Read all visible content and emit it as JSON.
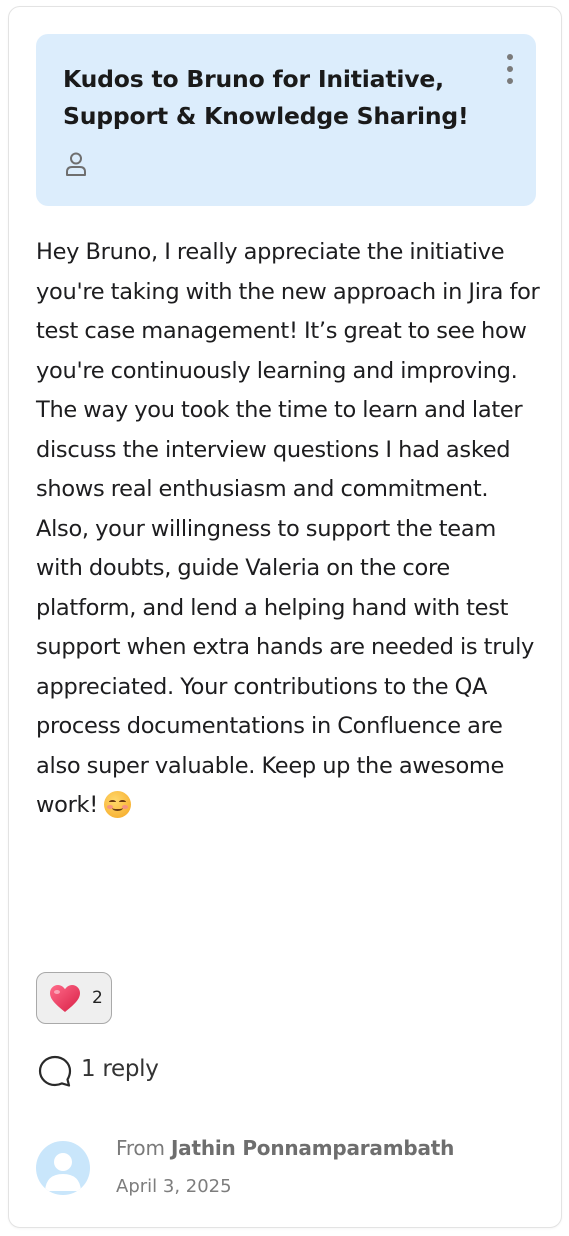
{
  "post": {
    "title": "Kudos to Bruno for Initiative, Support & Knowledge Sharing!",
    "message": "Hey Bruno, I really appreciate the initiative you're taking with the new approach in Jira for test case management! It’s great to see how you're continuously learning and improving. The way you took the time to learn and later discuss the interview questions I had asked shows real enthusiasm and commitment. Also, your willingness to support the team with doubts, guide Valeria on the core platform, and lend a helping hand with test support when extra hands are needed is truly appreciated. Your contributions to the QA process documentations in Confluence are also super valuable. Keep up the awesome work!",
    "message_emoji": "smiling-face-icon"
  },
  "reactions": [
    {
      "icon": "heart-icon",
      "count": "2"
    }
  ],
  "replies": {
    "label": "1 reply"
  },
  "author": {
    "from_prefix": "From",
    "name": "Jathin Ponnamparambath",
    "date": "April 3, 2025"
  },
  "colors": {
    "header_bg": "#dcedfc",
    "avatar_bg": "#c9e6fb",
    "heart": "#e8344e"
  }
}
